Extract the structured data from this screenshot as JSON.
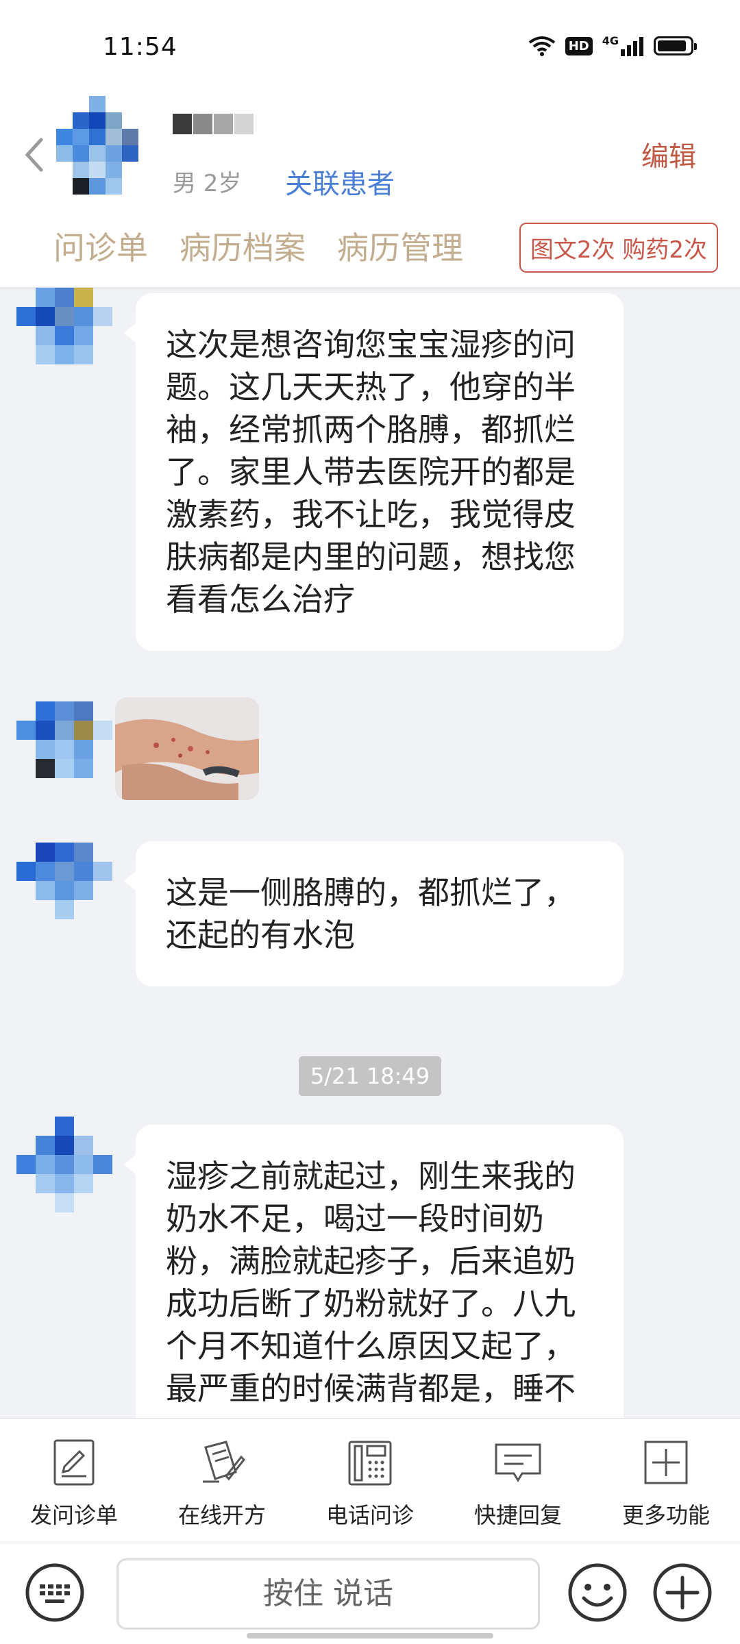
{
  "status_bar": {
    "time": "11:54",
    "hd": "HD",
    "network": "4G",
    "battery_level": 0.9
  },
  "header": {
    "patient_meta": "男 2岁",
    "link_patient": "关联患者",
    "edit": "编辑",
    "tabs": [
      {
        "label": "问诊单"
      },
      {
        "label": "病历档案"
      },
      {
        "label": "病历管理"
      }
    ],
    "service_badge": "图文2次 购药2次"
  },
  "messages": [
    {
      "type": "text",
      "text": "这次是想咨询您宝宝湿疹的问题。这几天天热了，他穿的半袖，经常抓两个胳膊，都抓烂了。家里人带去医院开的都是激素药，我不让吃，我觉得皮肤病都是内里的问题，想找您看看怎么治疗"
    },
    {
      "type": "image"
    },
    {
      "type": "text",
      "text": "这是一侧胳膊的，都抓烂了，还起的有水泡"
    },
    {
      "type": "time",
      "text": "5/21 18:49"
    },
    {
      "type": "text",
      "text": "湿疹之前就起过，刚生来我的奶水不足，喝过一段时间奶粉，满脸就起疹子，后来追奶成功后断了奶粉就好了。八九个月不知道什么原因又起了，最严重的时候满背都是，睡不"
    }
  ],
  "toolbar": [
    {
      "label": "发问诊单",
      "icon": "form-edit-icon"
    },
    {
      "label": "在线开方",
      "icon": "prescription-icon"
    },
    {
      "label": "电话问诊",
      "icon": "phone-icon"
    },
    {
      "label": "快捷回复",
      "icon": "message-icon"
    },
    {
      "label": "更多功能",
      "icon": "plus-box-icon"
    }
  ],
  "input_bar": {
    "voice_label": "按住 说话"
  },
  "colors": {
    "accent_blue": "#4a7fd6",
    "edit_red": "#c05a44",
    "tab_tan": "#c2ad8e",
    "badge_red": "#c8574a"
  }
}
